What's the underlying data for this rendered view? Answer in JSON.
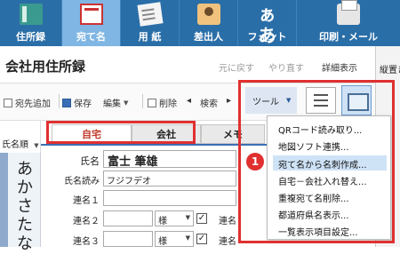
{
  "ribbon": {
    "items": [
      {
        "label": "住所録",
        "icon": "address-book-icon"
      },
      {
        "label": "宛て名",
        "icon": "envelope-icon"
      },
      {
        "label": "用 紙",
        "icon": "paper-icon"
      },
      {
        "label": "差出人",
        "icon": "sender-icon"
      },
      {
        "label": "フォント",
        "icon_text": "ぁあ",
        "icon": "font-icon"
      },
      {
        "label": "印刷・メール",
        "icon": "printer-icon"
      }
    ]
  },
  "header": {
    "title": "会社用住所録",
    "undo": "元に戻す",
    "redo": "やり直す",
    "details": "詳細表示",
    "right_panel_title": "縦置き"
  },
  "toolbar": {
    "add": "宛先追加",
    "save": "保存",
    "edit": "編集",
    "delete": "削除",
    "search": "検索",
    "tool": "ツール"
  },
  "index": {
    "sort": "氏名順",
    "kana": [
      "あ",
      "か",
      "さ",
      "た",
      "な"
    ]
  },
  "tabs": [
    "自宅",
    "会社",
    "メモ"
  ],
  "form": {
    "name_label": "氏名",
    "name_value": "富士 筆雄",
    "reading_label": "氏名読み",
    "reading_value": "フジフデオ",
    "joint1_label": "連名１",
    "joint2_label": "連名２",
    "joint3_label": "連名３",
    "honorific": "様",
    "right_joint2_label": "連名",
    "right_joint3_label": "連名"
  },
  "menu": {
    "items": [
      "QRコード読み取り...",
      "地図ソフト連携...",
      "宛て名から名刺作成...",
      "自宅－会社入れ替え...",
      "重複宛て名削除...",
      "都道府県名表示...",
      "一覧表示項目設定..."
    ],
    "highlighted_index": 2,
    "badge": "1"
  },
  "colors": {
    "ribbon": "#2a6ea8",
    "ribbon_selected": "#7fb6e3",
    "highlight_red": "#e03030",
    "active_tab_text": "#c0392b"
  }
}
